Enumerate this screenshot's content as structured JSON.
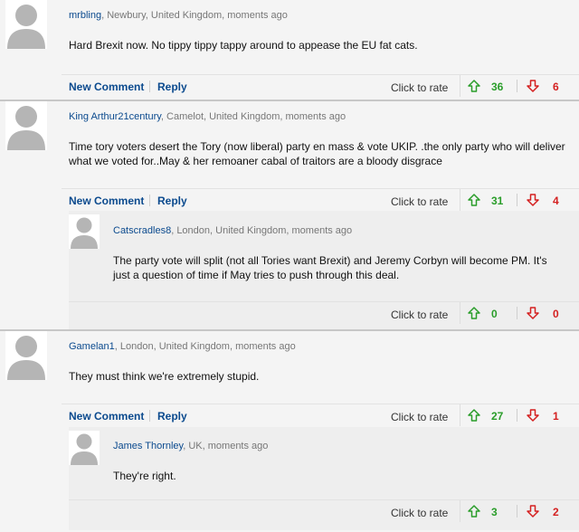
{
  "labels": {
    "new_comment": "New Comment",
    "reply": "Reply",
    "click_to_rate": "Click to rate"
  },
  "icons": {
    "up": "thumb-up-arrow-icon",
    "down": "thumb-down-arrow-icon",
    "avatar": "user-silhouette-icon"
  },
  "colors": {
    "author": "#0b4a8e",
    "up": "#2a9d2a",
    "down": "#d42020"
  },
  "comments": [
    {
      "author": "mrbling",
      "meta": ", Newbury, United Kingdom, moments ago",
      "text": "Hard Brexit now. No tippy tippy tappy around to appease the EU fat cats.",
      "up": "36",
      "down": "6"
    },
    {
      "author": "King Arthur21century",
      "meta": ", Camelot, United Kingdom, moments ago",
      "text": "Time tory voters desert the Tory (now liberal) party en mass & vote UKIP. .the only party who will deliver what we voted for..May & her remoaner cabal of traitors are a bloody disgrace",
      "up": "31",
      "down": "4"
    },
    {
      "author": "Catscradles8",
      "meta": ", London, United Kingdom, moments ago",
      "text": "The party vote will split (not all Tories want Brexit) and Jeremy Corbyn will become PM. It's just a question of time if May tries to push through this deal.",
      "up": "0",
      "down": "0"
    },
    {
      "author": "Gamelan1",
      "meta": ", London, United Kingdom, moments ago",
      "text": "They must think we're extremely stupid.",
      "up": "27",
      "down": "1"
    },
    {
      "author": "James Thornley",
      "meta": ", UK, moments ago",
      "text": "They're right.",
      "up": "3",
      "down": "2"
    }
  ]
}
